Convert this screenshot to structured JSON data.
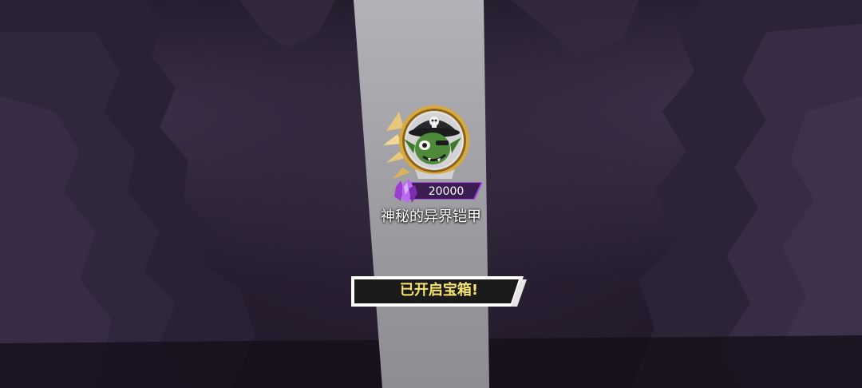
{
  "scene": {
    "icons": [
      "cave-background",
      "light-beam",
      "pirate-goblin-medal-icon",
      "purple-crystal-icon"
    ]
  },
  "reward": {
    "item_name": "神秘的异界铠甲",
    "price": "20000"
  },
  "status": {
    "message": "已开启宝箱!"
  },
  "colors": {
    "background": "#231a2c",
    "beam": "#9a9a9e",
    "gold": "#d9a93b",
    "crystal": "#9b3fd1",
    "status_text": "#f7e46a",
    "banner_bg": "#1b1b1b"
  }
}
